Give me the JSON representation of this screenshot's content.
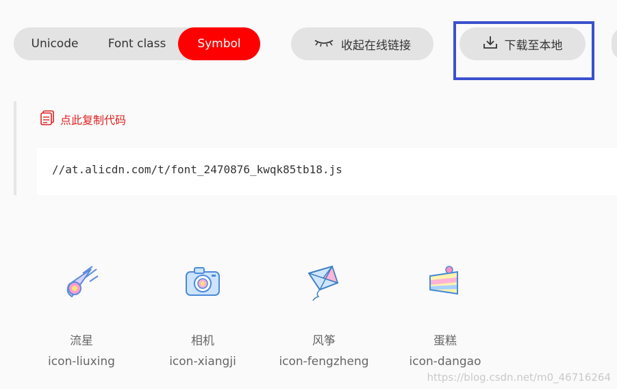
{
  "tabs": [
    {
      "label": "Unicode",
      "active": false
    },
    {
      "label": "Font class",
      "active": false
    },
    {
      "label": "Symbol",
      "active": true
    }
  ],
  "actions": {
    "collapse_label": "收起在线链接",
    "download_label": "下载至本地"
  },
  "code_section": {
    "copy_label": "点此复制代码",
    "code": "//at.alicdn.com/t/font_2470876_kwqk85tb18.js"
  },
  "icons": [
    {
      "cn": "流星",
      "en": "icon-liuxing",
      "icon": "meteor-icon"
    },
    {
      "cn": "相机",
      "en": "icon-xiangji",
      "icon": "camera-icon"
    },
    {
      "cn": "风筝",
      "en": "icon-fengzheng",
      "icon": "kite-icon"
    },
    {
      "cn": "蛋糕",
      "en": "icon-dangao",
      "icon": "cake-icon"
    }
  ],
  "watermark": "https://blog.csdn.net/m0_46716264",
  "colors": {
    "active_tab": "#ff0000",
    "copy_link": "#e02020",
    "highlight_box": "#3b50ce"
  }
}
